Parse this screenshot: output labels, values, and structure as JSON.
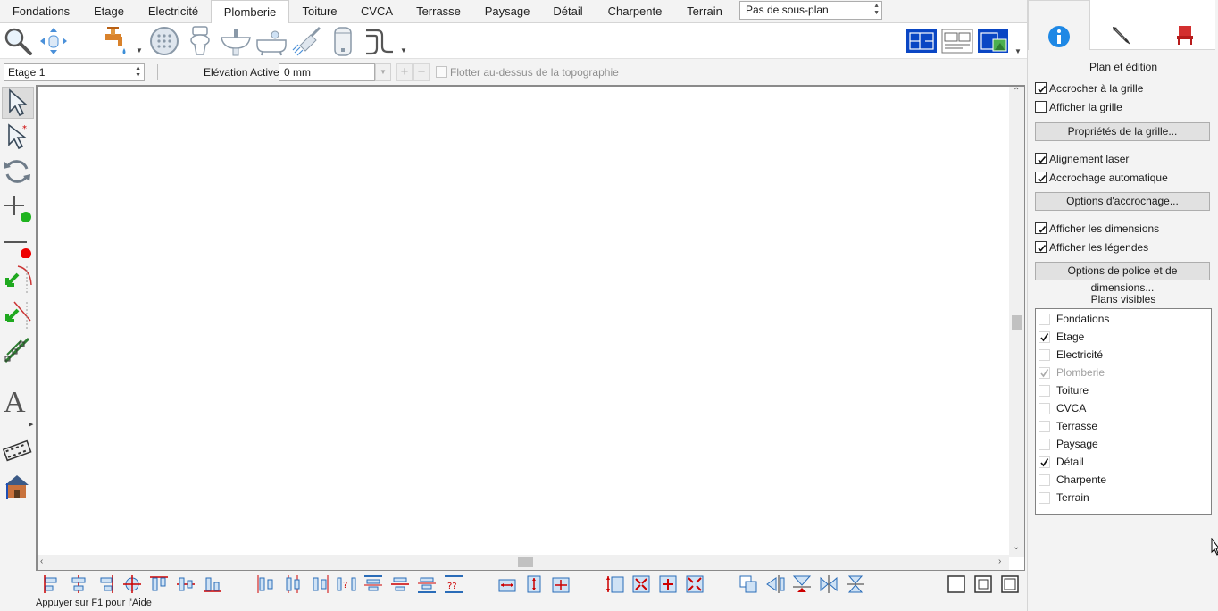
{
  "tabs": [
    {
      "label": "Fondations",
      "active": false
    },
    {
      "label": "Etage",
      "active": false
    },
    {
      "label": "Electricité",
      "active": false
    },
    {
      "label": "Plomberie",
      "active": true
    },
    {
      "label": "Toiture",
      "active": false
    },
    {
      "label": "CVCA",
      "active": false
    },
    {
      "label": "Terrasse",
      "active": false
    },
    {
      "label": "Paysage",
      "active": false
    },
    {
      "label": "Détail",
      "active": false
    },
    {
      "label": "Charpente",
      "active": false
    },
    {
      "label": "Terrain",
      "active": false
    }
  ],
  "subplan": {
    "value": "Pas de sous-plan"
  },
  "optionsbar": {
    "floor": "Etage 1",
    "elevation_label": "Elévation Active:",
    "elevation_value": "0 mm",
    "float_label": "Flotter au-dessus de la topographie"
  },
  "status": {
    "text": "Appuyer sur F1 pour l'Aide"
  },
  "panel": {
    "title": "Plan et édition",
    "snap_grid": {
      "label": "Accrocher à la grille",
      "checked": true
    },
    "show_grid": {
      "label": "Afficher la grille",
      "checked": false
    },
    "grid_props_button": "Propriétés de la grille...",
    "laser_align": {
      "label": "Alignement laser",
      "checked": true
    },
    "auto_snap": {
      "label": "Accrochage automatique",
      "checked": true
    },
    "snap_options_button": "Options d'accrochage...",
    "show_dimensions": {
      "label": "Afficher les dimensions",
      "checked": true
    },
    "show_legends": {
      "label": "Afficher les légendes",
      "checked": true
    },
    "font_options_button": "Options de police et de dimensions...",
    "visible_title": "Plans visibles",
    "visible_plans": [
      {
        "label": "Fondations",
        "checked": false,
        "disabled": false
      },
      {
        "label": "Etage",
        "checked": true,
        "disabled": false
      },
      {
        "label": "Electricité",
        "checked": false,
        "disabled": false
      },
      {
        "label": "Plomberie",
        "checked": true,
        "disabled": true
      },
      {
        "label": "Toiture",
        "checked": false,
        "disabled": false
      },
      {
        "label": "CVCA",
        "checked": false,
        "disabled": false
      },
      {
        "label": "Terrasse",
        "checked": false,
        "disabled": false
      },
      {
        "label": "Paysage",
        "checked": false,
        "disabled": false
      },
      {
        "label": "Détail",
        "checked": true,
        "disabled": false
      },
      {
        "label": "Charpente",
        "checked": false,
        "disabled": false
      },
      {
        "label": "Terrain",
        "checked": false,
        "disabled": false
      }
    ]
  }
}
